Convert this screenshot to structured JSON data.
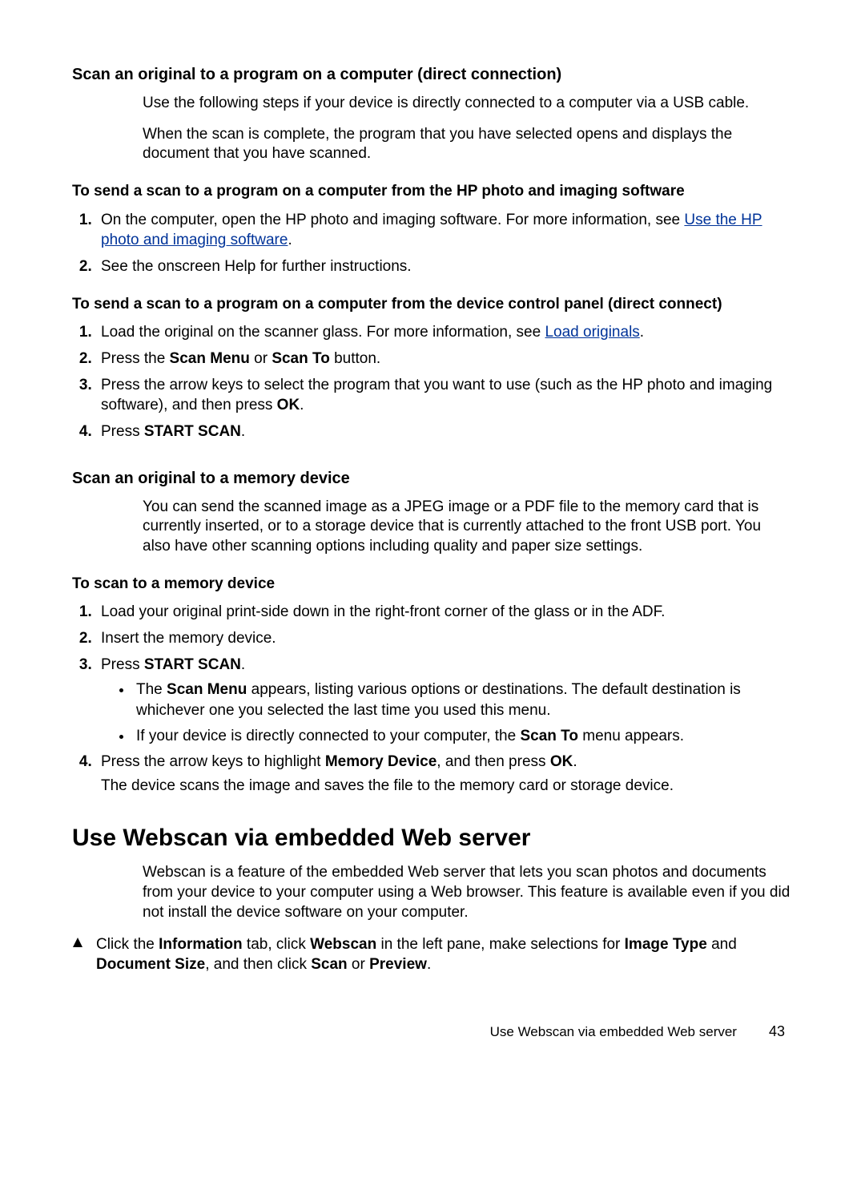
{
  "section1": {
    "heading": "Scan an original to a program on a computer (direct connection)",
    "p1": "Use the following steps if your device is directly connected to a computer via a USB cable.",
    "p2": "When the scan is complete, the program that you have selected opens and displays the document that you have scanned.",
    "sub1_heading": "To send a scan to a program on a computer from the HP photo and imaging software",
    "sub1_item1_pre": "On the computer, open the HP photo and imaging software. For more information, see ",
    "sub1_item1_link": "Use the HP photo and imaging software",
    "sub1_item1_post": ".",
    "sub1_item2": "See the onscreen Help for further instructions.",
    "sub2_heading": "To send a scan to a program on a computer from the device control panel (direct connect)",
    "sub2_item1_pre": "Load the original on the scanner glass. For more information, see ",
    "sub2_item1_link": "Load originals",
    "sub2_item1_post": ".",
    "sub2_item2_a": "Press the ",
    "sub2_item2_b": "Scan Menu",
    "sub2_item2_c": " or ",
    "sub2_item2_d": "Scan To",
    "sub2_item2_e": " button.",
    "sub2_item3_a": "Press the arrow keys to select the program that you want to use (such as the HP photo and imaging software), and then press ",
    "sub2_item3_b": "OK",
    "sub2_item3_c": ".",
    "sub2_item4_a": "Press ",
    "sub2_item4_b": "START SCAN",
    "sub2_item4_c": "."
  },
  "section2": {
    "heading": "Scan an original to a memory device",
    "p1": "You can send the scanned image as a JPEG image or a PDF file to the memory card that is currently inserted, or to a storage device that is currently attached to the front USB port. You also have other scanning options including quality and paper size settings.",
    "sub1_heading": "To scan to a memory device",
    "i1": "Load your original print-side down in the right-front corner of the glass or in the ADF.",
    "i2": "Insert the memory device.",
    "i3_a": "Press ",
    "i3_b": "START SCAN",
    "i3_c": ".",
    "b1_a": "The ",
    "b1_b": "Scan Menu",
    "b1_c": " appears, listing various options or destinations. The default destination is whichever one you selected the last time you used this menu.",
    "b2_a": "If your device is directly connected to your computer, the ",
    "b2_b": "Scan To",
    "b2_c": " menu appears.",
    "i4_a": "Press the arrow keys to highlight ",
    "i4_b": "Memory Device",
    "i4_c": ", and then press ",
    "i4_d": "OK",
    "i4_e": ".",
    "i4_p2": "The device scans the image and saves the file to the memory card or storage device."
  },
  "section3": {
    "heading": "Use Webscan via embedded Web server",
    "p1": "Webscan is a feature of the embedded Web server that lets you scan photos and documents from your device to your computer using a Web browser. This feature is available even if you did not install the device software on your computer.",
    "t_a": "Click the ",
    "t_b": "Information",
    "t_c": " tab, click ",
    "t_d": "Webscan",
    "t_e": " in the left pane, make selections for ",
    "t_f": "Image Type",
    "t_g": " and ",
    "t_h": "Document Size",
    "t_i": ", and then click ",
    "t_j": "Scan",
    "t_k": " or ",
    "t_l": "Preview",
    "t_m": "."
  },
  "footer": {
    "title": "Use Webscan via embedded Web server",
    "page": "43"
  }
}
